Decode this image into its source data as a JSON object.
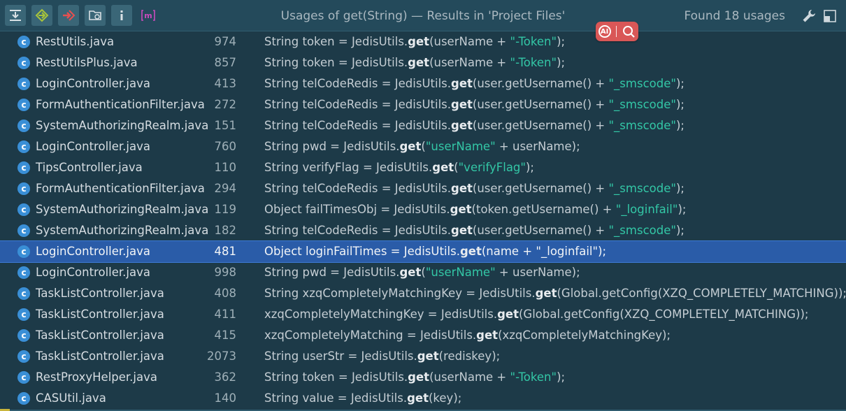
{
  "window": {
    "title": "Usages of get(String) — Results in 'Project Files'",
    "found_label": "Found 18 usages"
  },
  "toolbar": {
    "icons": [
      "expand-all-icon",
      "previous-occurrence-icon",
      "next-occurrence-icon",
      "group-by-icon",
      "info-icon",
      "module-icon"
    ],
    "plugin_letter": "m"
  },
  "ai_badge": {
    "label": "AI"
  },
  "colors": {
    "background": "#1d3a48",
    "selected_row": "#2a5ca8",
    "string_literal": "#33c7a6",
    "class_icon": "#3a8fd6",
    "ai_pill": "#d95757"
  },
  "usages": [
    {
      "file": "RestUtils.java",
      "line": "974",
      "pre": "String token = JedisUtils.",
      "method": "get",
      "mid": "(userName + ",
      "str": "\"-Token\"",
      "post": ");"
    },
    {
      "file": "RestUtilsPlus.java",
      "line": "857",
      "pre": "String token = JedisUtils.",
      "method": "get",
      "mid": "(userName + ",
      "str": "\"-Token\"",
      "post": ");"
    },
    {
      "file": "LoginController.java",
      "line": "413",
      "pre": "String telCodeRedis = JedisUtils.",
      "method": "get",
      "mid": "(user.getUsername() + ",
      "str": "\"_smscode\"",
      "post": ");"
    },
    {
      "file": "FormAuthenticationFilter.java",
      "line": "272",
      "pre": "String telCodeRedis = JedisUtils.",
      "method": "get",
      "mid": "(user.getUsername() + ",
      "str": "\"_smscode\"",
      "post": ");"
    },
    {
      "file": "SystemAuthorizingRealm.java",
      "line": "151",
      "pre": "String telCodeRedis = JedisUtils.",
      "method": "get",
      "mid": "(user.getUsername() + ",
      "str": "\"_smscode\"",
      "post": ");"
    },
    {
      "file": "LoginController.java",
      "line": "760",
      "pre": "String pwd = JedisUtils.",
      "method": "get",
      "mid": "(",
      "str": "\"userName\"",
      "post": " + userName);"
    },
    {
      "file": "TipsController.java",
      "line": "110",
      "pre": "String verifyFlag = JedisUtils.",
      "method": "get",
      "mid": "(",
      "str": "\"verifyFlag\"",
      "post": ");"
    },
    {
      "file": "FormAuthenticationFilter.java",
      "line": "294",
      "pre": "String telCodeRedis = JedisUtils.",
      "method": "get",
      "mid": "(user.getUsername() + ",
      "str": "\"_smscode\"",
      "post": ");"
    },
    {
      "file": "SystemAuthorizingRealm.java",
      "line": "119",
      "pre": "Object failTimesObj = JedisUtils.",
      "method": "get",
      "mid": "(token.getUsername() + ",
      "str": "\"_loginfail\"",
      "post": ");"
    },
    {
      "file": "SystemAuthorizingRealm.java",
      "line": "182",
      "pre": "String telCodeRedis = JedisUtils.",
      "method": "get",
      "mid": "(user.getUsername() + ",
      "str": "\"_smscode\"",
      "post": ");"
    },
    {
      "file": "LoginController.java",
      "line": "481",
      "pre": "Object loginFailTimes = JedisUtils.",
      "method": "get",
      "mid": "(name + ",
      "str": "\"_loginfail\"",
      "post": ");",
      "selected": true
    },
    {
      "file": "LoginController.java",
      "line": "998",
      "pre": "String pwd = JedisUtils.",
      "method": "get",
      "mid": "(",
      "str": "\"userName\"",
      "post": " + userName);"
    },
    {
      "file": "TaskListController.java",
      "line": "408",
      "pre": "String xzqCompletelyMatchingKey = JedisUtils.",
      "method": "get",
      "mid": "(Global.getConfig(XZQ_COMPLETELY_MATCHING));",
      "str": "",
      "post": ""
    },
    {
      "file": "TaskListController.java",
      "line": "411",
      "pre": "xzqCompletelyMatchingKey = JedisUtils.",
      "method": "get",
      "mid": "(Global.getConfig(XZQ_COMPLETELY_MATCHING));",
      "str": "",
      "post": ""
    },
    {
      "file": "TaskListController.java",
      "line": "415",
      "pre": "xzqCompletelyMatching = JedisUtils.",
      "method": "get",
      "mid": "(xzqCompletelyMatchingKey);",
      "str": "",
      "post": ""
    },
    {
      "file": "TaskListController.java",
      "line": "2073",
      "pre": "String userStr = JedisUtils.",
      "method": "get",
      "mid": "(rediskey);",
      "str": "",
      "post": ""
    },
    {
      "file": "RestProxyHelper.java",
      "line": "362",
      "pre": "String token = JedisUtils.",
      "method": "get",
      "mid": "(userName + ",
      "str": "\"-Token\"",
      "post": ");"
    },
    {
      "file": "CASUtil.java",
      "line": "140",
      "pre": "String value = JedisUtils.",
      "method": "get",
      "mid": "(key);",
      "str": "",
      "post": ""
    }
  ]
}
